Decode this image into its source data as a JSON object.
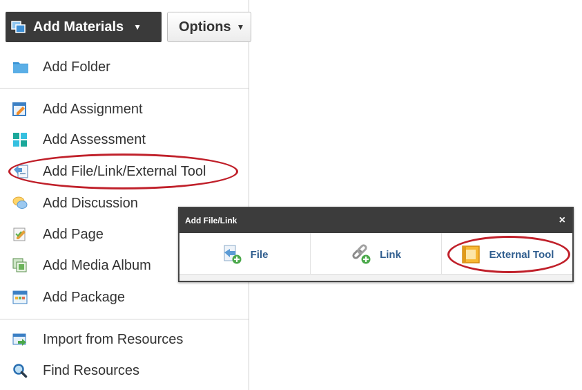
{
  "toolbar": {
    "add_materials_label": "Add Materials",
    "options_label": "Options"
  },
  "menu": {
    "items": [
      {
        "label": "Add Folder",
        "icon": "folder-icon"
      },
      {
        "label": "Add Assignment",
        "icon": "assignment-icon"
      },
      {
        "label": "Add Assessment",
        "icon": "assessment-icon"
      },
      {
        "label": "Add File/Link/External Tool",
        "icon": "file-link-icon"
      },
      {
        "label": "Add Discussion",
        "icon": "discussion-icon"
      },
      {
        "label": "Add Page",
        "icon": "page-icon"
      },
      {
        "label": "Add Media Album",
        "icon": "media-album-icon"
      },
      {
        "label": "Add Package",
        "icon": "package-icon"
      },
      {
        "label": "Import from Resources",
        "icon": "import-icon"
      },
      {
        "label": "Find Resources",
        "icon": "magnifier-icon"
      }
    ]
  },
  "dialog": {
    "title": "Add File/Link",
    "close": "×",
    "options": [
      {
        "label": "File",
        "icon": "file-upload-icon"
      },
      {
        "label": "Link",
        "icon": "link-icon"
      },
      {
        "label": "External Tool",
        "icon": "external-tool-icon"
      }
    ]
  },
  "colors": {
    "highlight": "#c0202a",
    "dark_header": "#3a3a3a",
    "link_text": "#2f5d8e"
  }
}
